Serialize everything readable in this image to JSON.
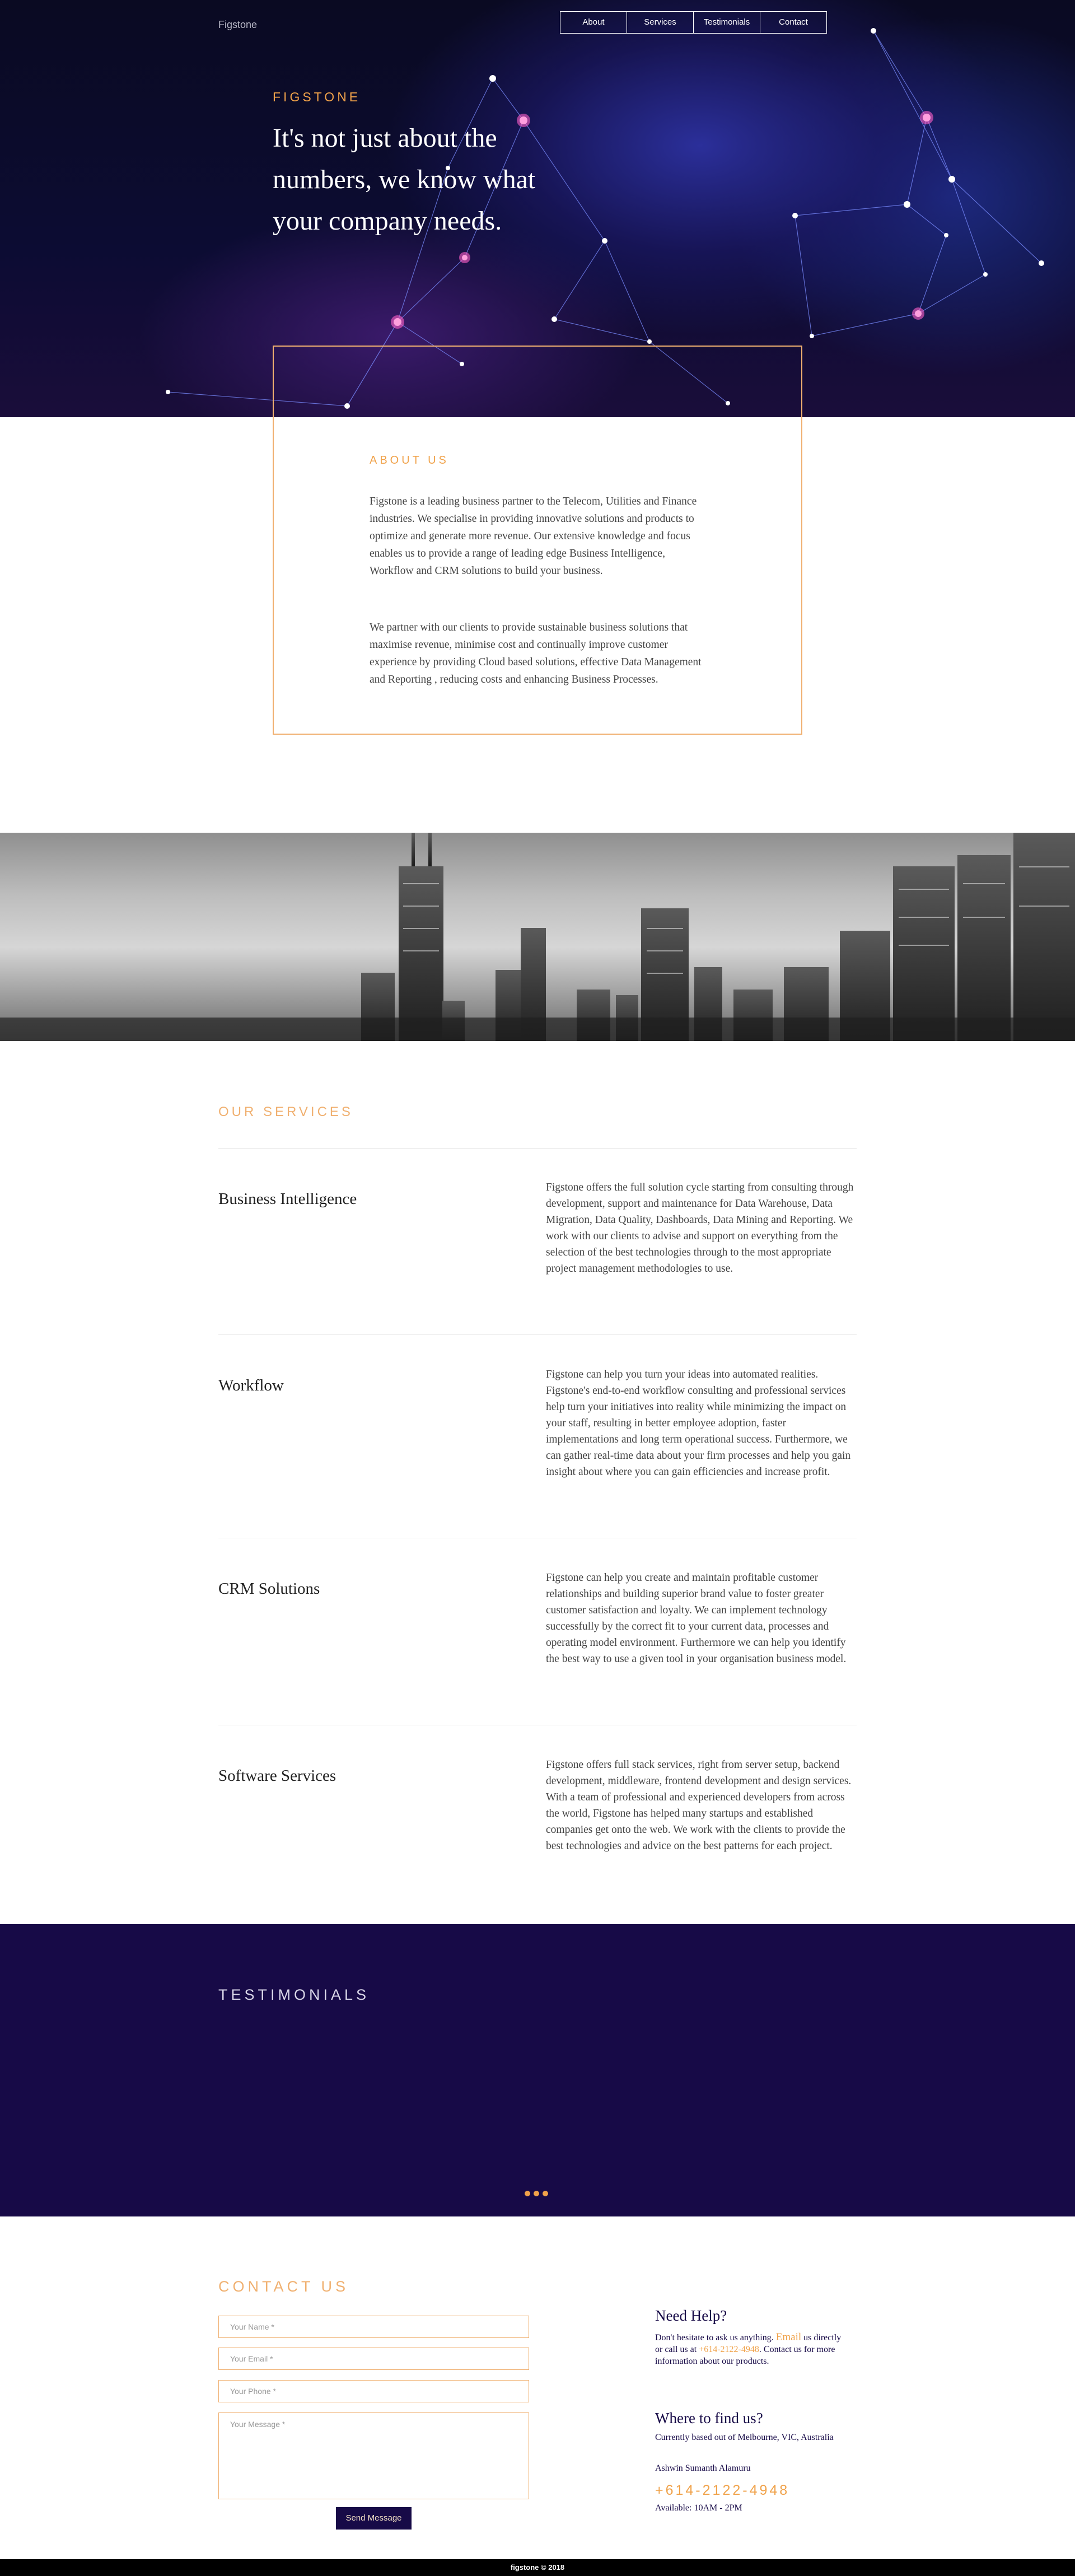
{
  "header": {
    "logo": "Figstone",
    "nav": [
      "About",
      "Services",
      "Testimonials",
      "Contact"
    ]
  },
  "hero": {
    "kicker": "FIGSTONE",
    "title": "It's not just about the numbers, we know what your company needs."
  },
  "about": {
    "kicker": "ABOUT US",
    "p1": "Figstone is a leading business partner to the Telecom, Utilities and Finance industries. We specialise in providing innovative solutions and products to optimize and generate more revenue. Our extensive knowledge and focus enables us to provide a range of leading edge Business Intelligence, Workflow and CRM solutions to build your business.",
    "p2": "We partner with our clients to provide sustainable business solutions that maximise revenue, minimise cost and continually improve customer experience by providing Cloud based solutions, effective Data Management and Reporting , reducing costs and enhancing Business Processes."
  },
  "services": {
    "kicker": "OUR SERVICES",
    "items": [
      {
        "title": "Business Intelligence",
        "desc": "Figstone offers the full solution cycle starting from consulting through development, support and maintenance for Data Warehouse, Data Migration, Data Quality, Dashboards, Data Mining and Reporting. We work with our clients to advise and support on everything from the selection of the best technologies through to the most appropriate project management methodologies to use."
      },
      {
        "title": "Workflow",
        "desc": "Figstone can help you turn your ideas into automated realities. Figstone's end-to-end workflow consulting and professional services help turn your initiatives into reality while minimizing the impact on your staff, resulting in better employee adoption, faster implementations and long term operational success. Furthermore, we can gather real-time data about your firm processes and help you gain insight about where you can gain efficiencies and increase profit."
      },
      {
        "title": "CRM Solutions",
        "desc": "Figstone can help you create and maintain profitable customer relationships and building superior brand value to foster greater customer satisfaction and loyalty. We can implement technology successfully by the correct fit to your current data, processes and operating model environment. Furthermore we can help you identify the best way to use a given tool in your organisation business model."
      },
      {
        "title": "Software Services",
        "desc": "Figstone offers full stack services, right from server setup, backend development, middleware, frontend development and design services. With a team of professional and experienced developers from across the world, Figstone has helped many startups and established companies get onto the web. We work with the clients to provide the best technologies and advice on the best patterns for each project."
      }
    ]
  },
  "testimonials": {
    "kicker": "TESTIMONIALS"
  },
  "contact": {
    "kicker": "CONTACT US",
    "name_placeholder": "Your Name *",
    "email_placeholder": "Your Email *",
    "phone_placeholder": "Your Phone *",
    "message_placeholder": "Your Message *",
    "send_label": "Send Message",
    "help_title": "Need Help?",
    "help_text_1": "Don't hesitate to ask us anything.",
    "help_email": "Email",
    "help_text_2": "us directly or call us at",
    "help_phone_inline": "+614-2122-4948",
    "help_text_3": "Contact us for more information about our products.",
    "find_title": "Where to find us?",
    "location": "Currently based out of Melbourne, VIC, Australia",
    "person": "Ashwin Sumanth Alamuru",
    "phone": "+614-2122-4948",
    "hours": "Available: 10AM - 2PM"
  },
  "footer": {
    "copyright": "figstone © 2018"
  }
}
